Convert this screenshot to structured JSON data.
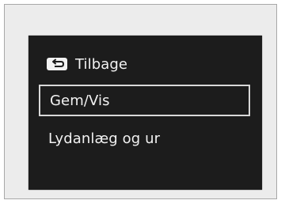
{
  "menu": {
    "back": {
      "icon": "back-arrow-icon",
      "label": "Tilbage"
    },
    "items": [
      {
        "label": "Gem/Vis",
        "selected": true
      },
      {
        "label": "Lydanlæg og ur",
        "selected": false
      }
    ]
  },
  "colors": {
    "screen_background": "#1c1c1c",
    "text": "#f2f2f2",
    "selection_border": "#d8d8d8",
    "frame_background": "#ececec"
  }
}
